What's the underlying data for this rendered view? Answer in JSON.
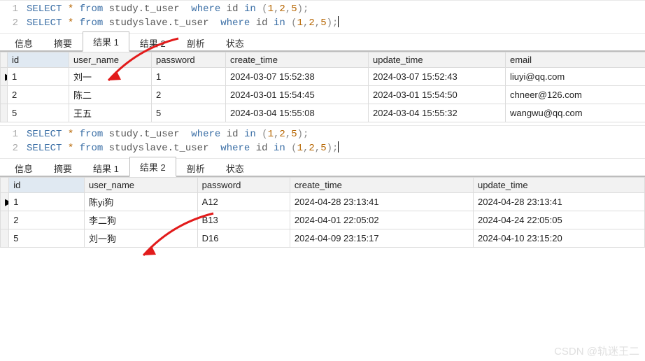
{
  "sql": {
    "lines": [
      {
        "n": "1",
        "tokens": [
          "SELECT",
          " ",
          "*",
          " ",
          "from",
          " ",
          "study.t_user",
          "  ",
          "where",
          " ",
          "id",
          " ",
          "in",
          " ",
          "(",
          "1",
          ",",
          "2",
          ",",
          "5",
          ")",
          ";"
        ]
      },
      {
        "n": "2",
        "tokens": [
          "SELECT",
          " ",
          "*",
          " ",
          "from",
          " ",
          "studyslave.t_user",
          "  ",
          "where",
          " ",
          "id",
          " ",
          "in",
          " ",
          "(",
          "1",
          ",",
          "2",
          ",",
          "5",
          ")",
          ";"
        ]
      }
    ]
  },
  "panel1": {
    "tabs": {
      "info": "信息",
      "summary": "摘要",
      "result1": "结果 1",
      "result2": "结果 2",
      "profile": "剖析",
      "status": "状态"
    },
    "activeTab": "result1",
    "columns": [
      "id",
      "user_name",
      "password",
      "create_time",
      "update_time",
      "email"
    ],
    "rows": [
      {
        "marker": "▶",
        "id": "1",
        "user_name": "刘一",
        "password": "1",
        "create_time": "2024-03-07 15:52:38",
        "update_time": "2024-03-07 15:52:43",
        "email": "liuyi@qq.com"
      },
      {
        "marker": "",
        "id": "2",
        "user_name": "陈二",
        "password": "2",
        "create_time": "2024-03-01 15:54:45",
        "update_time": "2024-03-01 15:54:50",
        "email": "chneer@126.com"
      },
      {
        "marker": "",
        "id": "5",
        "user_name": "王五",
        "password": "5",
        "create_time": "2024-03-04 15:55:08",
        "update_time": "2024-03-04 15:55:32",
        "email": "wangwu@qq.com"
      }
    ]
  },
  "panel2": {
    "tabs": {
      "info": "信息",
      "summary": "摘要",
      "result1": "结果 1",
      "result2": "结果 2",
      "profile": "剖析",
      "status": "状态"
    },
    "activeTab": "result2",
    "columns": [
      "id",
      "user_name",
      "password",
      "create_time",
      "update_time"
    ],
    "rows": [
      {
        "marker": "▶",
        "id": "1",
        "user_name": "陈yi狗",
        "password": "A12",
        "create_time": "2024-04-28 23:13:41",
        "update_time": "2024-04-28 23:13:41"
      },
      {
        "marker": "",
        "id": "2",
        "user_name": "李二狗",
        "password": "B13",
        "create_time": "2024-04-01 22:05:02",
        "update_time": "2024-04-24 22:05:05"
      },
      {
        "marker": "",
        "id": "5",
        "user_name": "刘一狗",
        "password": "D16",
        "create_time": "2024-04-09 23:15:17",
        "update_time": "2024-04-10 23:15:20"
      }
    ]
  },
  "watermark": "CSDN @轨迷王二"
}
